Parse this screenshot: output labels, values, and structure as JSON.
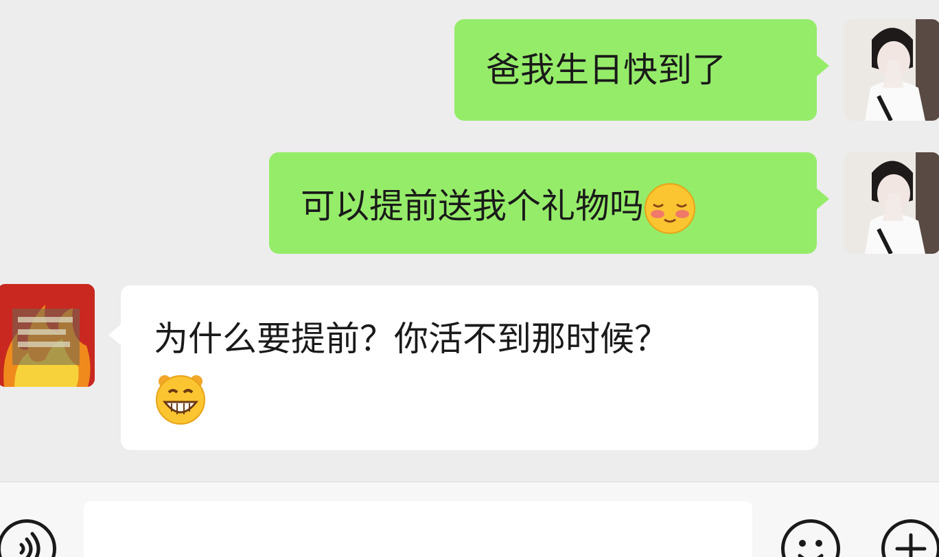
{
  "chat": {
    "messages": [
      {
        "sender": "me",
        "text": "爸我生日快到了"
      },
      {
        "sender": "me",
        "text": "可以提前送我个礼物吗",
        "emoji": "blushing-face"
      },
      {
        "sender": "dad",
        "text": "为什么要提前？你活不到那时候？",
        "emoji": "grinning-face"
      }
    ]
  },
  "input_bar": {
    "voice_icon": "voice-icon",
    "emoji_icon": "smiley-icon",
    "plus_icon": "plus-icon"
  },
  "colors": {
    "my_bubble": "#95ec69",
    "their_bubble": "#ffffff",
    "background": "#ededed"
  }
}
